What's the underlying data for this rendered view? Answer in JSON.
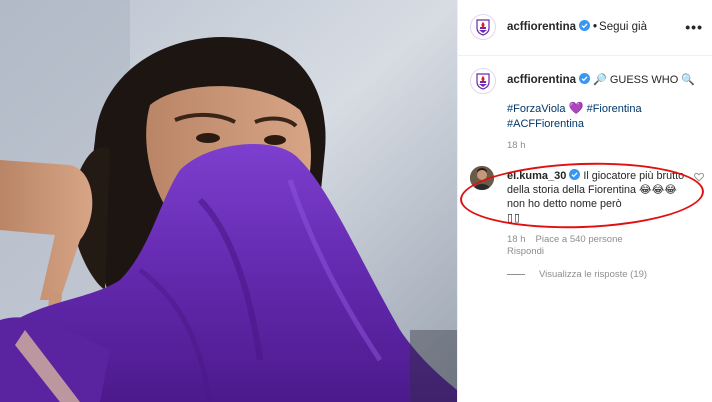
{
  "post": {
    "account": "acfFiorentina",
    "follow_label": "Segui già",
    "more_label": "•••"
  },
  "caption": {
    "handle": "acffiorentina",
    "text_line1": " 🔎 GUESS WHO 🔍",
    "tags_line2_a": "#ForzaViola",
    "tags_line2_heart": "💜",
    "tags_line2_b": "#Fiorentina",
    "tags_line3": "#ACFFiorentina",
    "time": "18 h"
  },
  "comment": {
    "handle": "el.kuma_30",
    "text": "Il giocatore più brutto della storia della Fiorentina 😂😂😂 non ho detto nome però",
    "tail": "▯▯",
    "time": "18 h",
    "likes": "Piace a 540 persone",
    "reply_label": "Rispondi",
    "view_replies": "Visualizza le risposte (19)"
  },
  "colors": {
    "purple": "#6a2bb0",
    "annotation_red": "#e01010",
    "link_blue": "#00376b",
    "verified_blue": "#3897f0"
  }
}
